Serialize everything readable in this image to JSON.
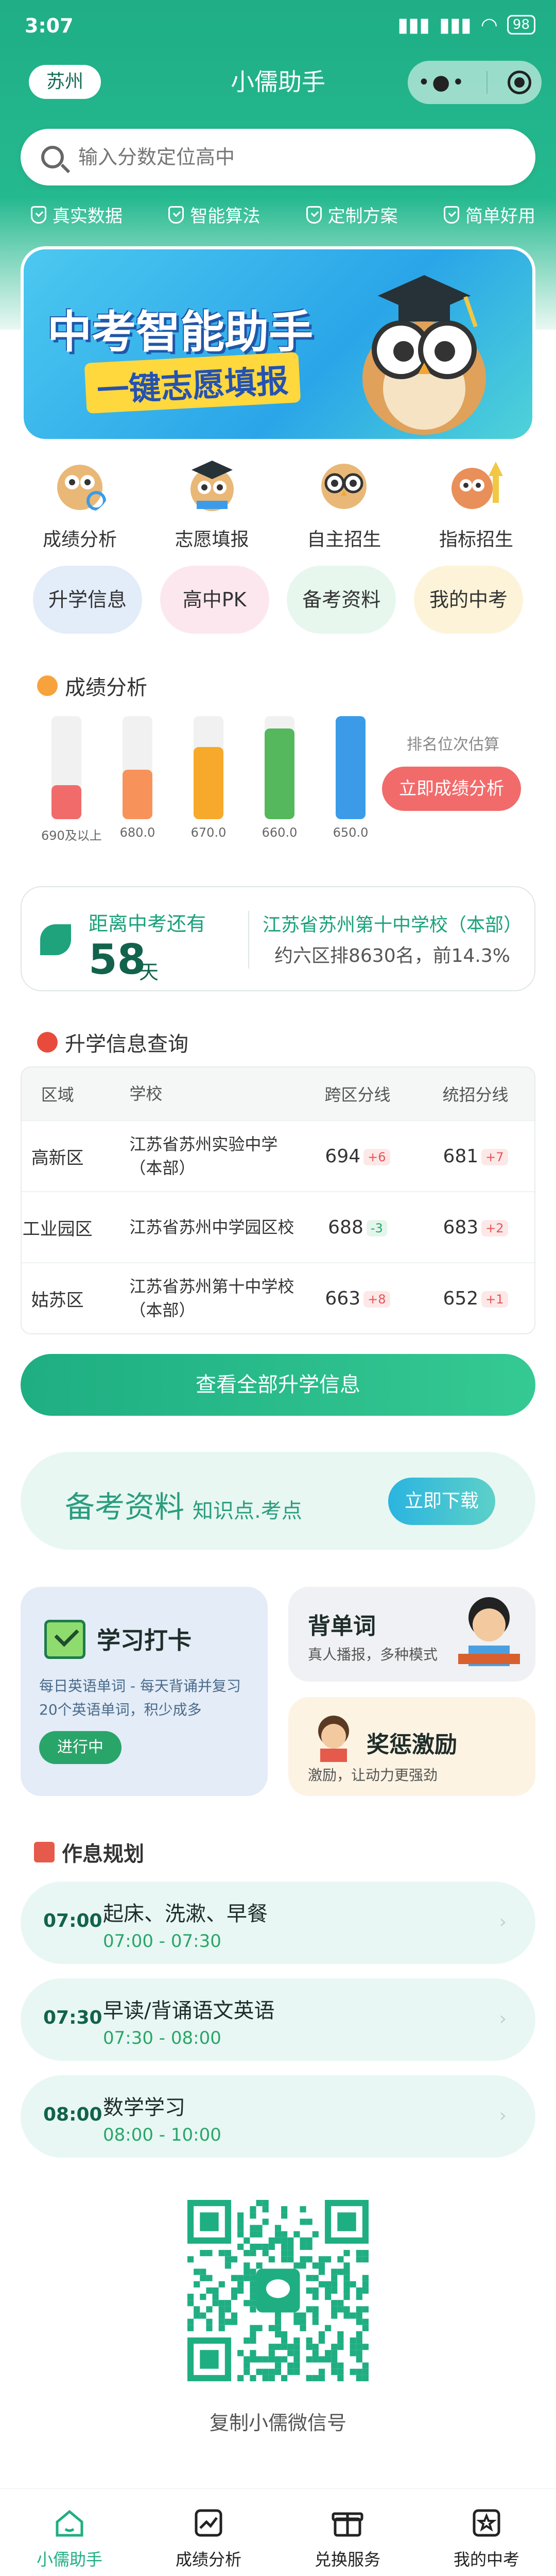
{
  "status": {
    "time": "3:07",
    "signal1": "",
    "battery": "98"
  },
  "header": {
    "city": "苏州",
    "title": "小儒助手"
  },
  "search": {
    "placeholder": "输入分数定位高中"
  },
  "features": [
    "真实数据",
    "智能算法",
    "定制方案",
    "简单好用"
  ],
  "banner": {
    "line1": "中考智能助手",
    "line2": "一键志愿填报"
  },
  "quick_icons": [
    {
      "label": "成绩分析",
      "icon": "owl-magnifier-icon"
    },
    {
      "label": "志愿填报",
      "icon": "owl-graduate-icon"
    },
    {
      "label": "自主招生",
      "icon": "owl-glasses-icon"
    },
    {
      "label": "指标招生",
      "icon": "owl-arrow-up-icon"
    }
  ],
  "pills": [
    {
      "label": "升学信息",
      "color": "#e3ecf9"
    },
    {
      "label": "高中PK",
      "color": "#fde7ef"
    },
    {
      "label": "备考资料",
      "color": "#e7f7ee"
    },
    {
      "label": "我的中考",
      "color": "#fdf3d9"
    }
  ],
  "score_section": {
    "title": "成绩分析",
    "rank_caption": "排名位次估算",
    "rank_button": "立即成绩分析"
  },
  "chart_data": {
    "type": "bar",
    "categories": [
      "690及以上",
      "680.0",
      "670.0",
      "660.0",
      "650.0"
    ],
    "values": [
      0.33,
      0.48,
      0.7,
      0.88,
      1.0
    ],
    "colors": [
      "#f26b6b",
      "#f7935a",
      "#f6a92a",
      "#55b85c",
      "#3b9be8"
    ]
  },
  "countdown": {
    "prefix": "距离中考还有",
    "days": "58",
    "unit": "天",
    "school": "江苏省苏州第十中学校（本部）",
    "rank": "约六区排8630名，前14.3%"
  },
  "admission": {
    "title": "升学信息查询",
    "headers": [
      "区域",
      "学校",
      "跨区分线",
      "统招分线"
    ],
    "rows": [
      {
        "district": "高新区",
        "school": "江苏省苏州实验中学（本部）",
        "cross": "694",
        "cross_delta": "+6",
        "cross_dir": "up",
        "total": "681",
        "total_delta": "+7",
        "total_dir": "up"
      },
      {
        "district": "工业园区",
        "school": "江苏省苏州中学园区校",
        "cross": "688",
        "cross_delta": "-3",
        "cross_dir": "down",
        "total": "683",
        "total_delta": "+2",
        "total_dir": "up"
      },
      {
        "district": "姑苏区",
        "school": "江苏省苏州第十中学校（本部）",
        "cross": "663",
        "cross_delta": "+8",
        "cross_dir": "up",
        "total": "652",
        "total_delta": "+1",
        "total_dir": "up"
      }
    ],
    "button": "查看全部升学信息"
  },
  "prep": {
    "title": "备考资料",
    "subtitle": "知识点.考点",
    "button": "立即下载"
  },
  "study_card": {
    "title": "学习打卡",
    "desc": "每日英语单词 - 每天背诵并复习20个英语单词，积少成多",
    "tag": "进行中"
  },
  "words_card": {
    "title": "背单词",
    "desc": "真人播报，多种模式"
  },
  "reward_card": {
    "title": "奖惩激励",
    "desc": "激励，让动力更强劲"
  },
  "schedule": {
    "title": "作息规划",
    "items": [
      {
        "time": "07:00",
        "name": "起床、洗漱、早餐",
        "range": "07:00 - 07:30"
      },
      {
        "time": "07:30",
        "name": "早读/背诵语文英语",
        "range": "07:30 - 08:00"
      },
      {
        "time": "08:00",
        "name": "数学学习",
        "range": "08:00 - 10:00"
      }
    ]
  },
  "qr": {
    "caption": "复制小儒微信号"
  },
  "tabbar": [
    {
      "label": "小儒助手",
      "active": true
    },
    {
      "label": "成绩分析",
      "active": false
    },
    {
      "label": "兑换服务",
      "active": false
    },
    {
      "label": "我的中考",
      "active": false
    }
  ]
}
